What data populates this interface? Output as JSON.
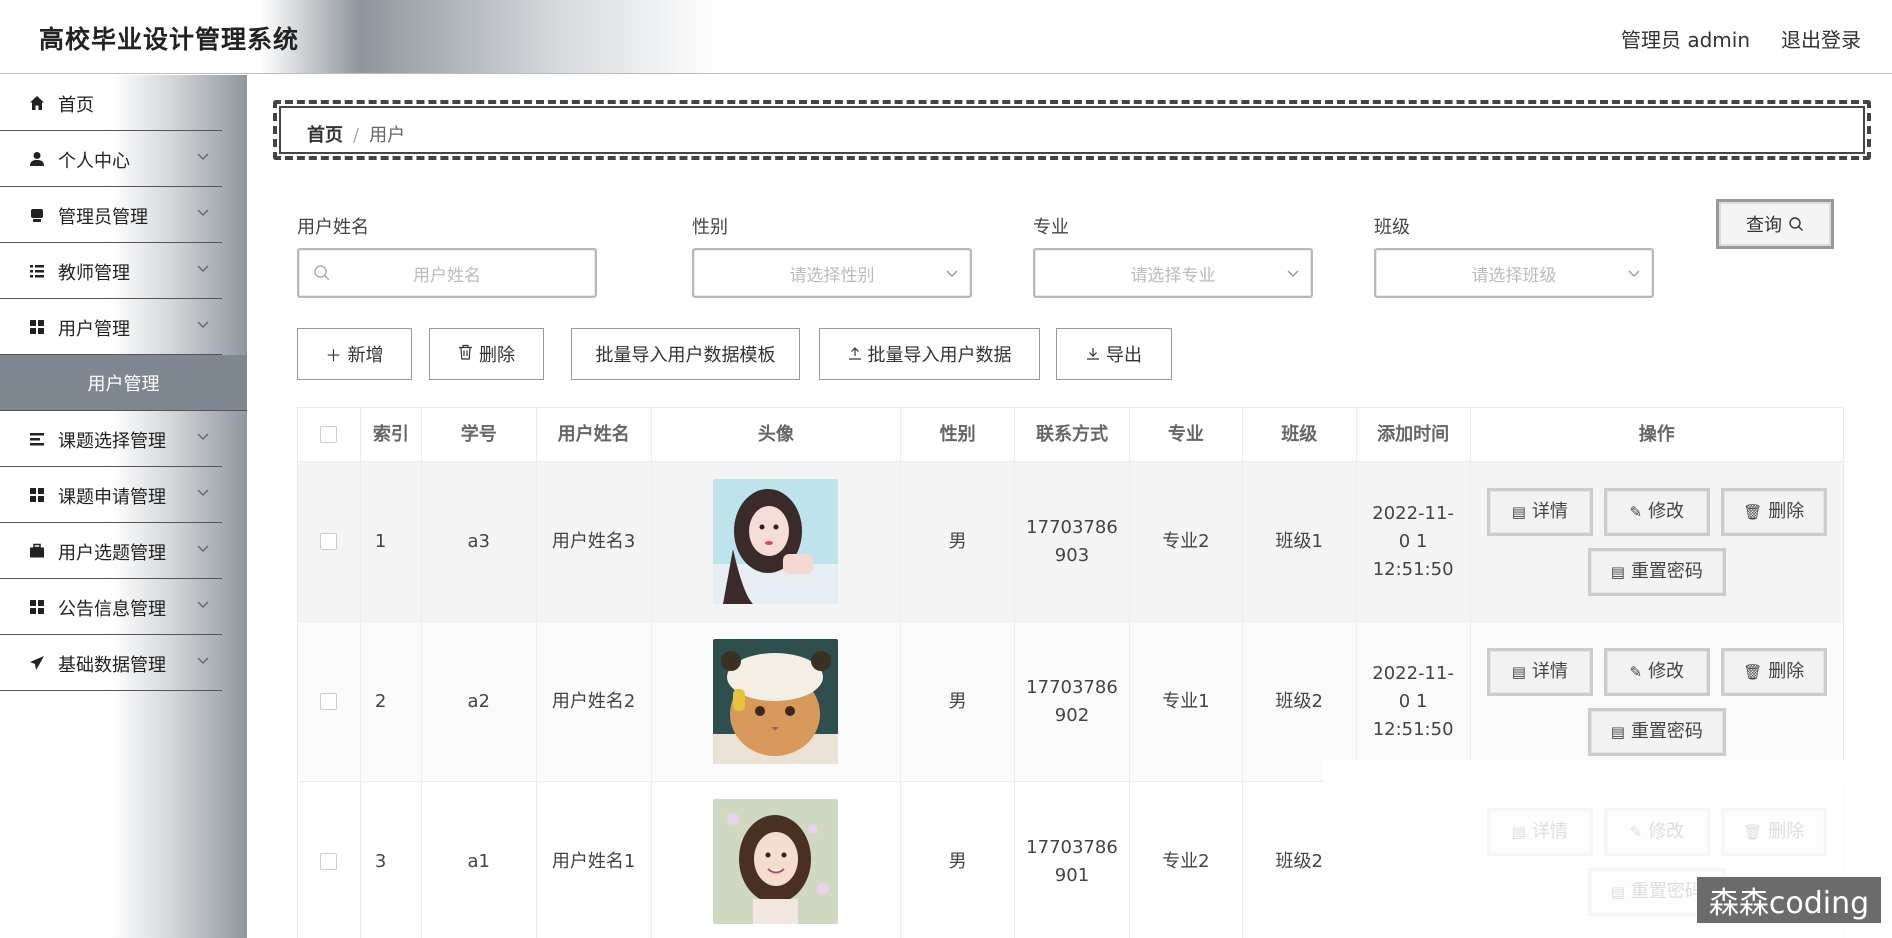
{
  "header": {
    "title": "高校毕业设计管理系统",
    "admin": "管理员 admin",
    "logout": "退出登录"
  },
  "sidebar": {
    "items": [
      {
        "label": "首页",
        "icon": "home-icon"
      },
      {
        "label": "个人中心",
        "icon": "user-icon"
      },
      {
        "label": "管理员管理",
        "icon": "admin-icon"
      },
      {
        "label": "教师管理",
        "icon": "list-icon"
      },
      {
        "label": "用户管理",
        "icon": "grid-icon"
      },
      {
        "label": "课题选择管理",
        "icon": "list-icon"
      },
      {
        "label": "课题申请管理",
        "icon": "grid-icon"
      },
      {
        "label": "用户选题管理",
        "icon": "briefcase-icon"
      },
      {
        "label": "公告信息管理",
        "icon": "grid-icon"
      },
      {
        "label": "基础数据管理",
        "icon": "send-icon"
      }
    ],
    "active_sub": "用户管理"
  },
  "breadcrumb": {
    "home": "首页",
    "sep": "/",
    "current": "用户"
  },
  "filters": {
    "name_label": "用户姓名",
    "name_placeholder": "用户姓名",
    "gender_label": "性别",
    "gender_placeholder": "请选择性别",
    "major_label": "专业",
    "major_placeholder": "请选择专业",
    "class_label": "班级",
    "class_placeholder": "请选择班级",
    "query": "查询"
  },
  "actions": {
    "add": "新增",
    "delete": "删除",
    "template": "批量导入用户数据模板",
    "import": "批量导入用户数据",
    "export": "导出"
  },
  "table": {
    "headers": [
      "索引",
      "学号",
      "用户姓名",
      "头像",
      "性别",
      "联系方式",
      "专业",
      "班级",
      "添加时间",
      "操作"
    ],
    "rows": [
      {
        "index": "1",
        "sid": "a3",
        "name": "用户姓名3",
        "gender": "男",
        "phone": "17703786 903",
        "major": "专业2",
        "class": "班级1",
        "time": "2022-11-0 1 12:51:50"
      },
      {
        "index": "2",
        "sid": "a2",
        "name": "用户姓名2",
        "gender": "男",
        "phone": "17703786 902",
        "major": "专业1",
        "class": "班级2",
        "time": "2022-11-0 1 12:51:50"
      },
      {
        "index": "3",
        "sid": "a1",
        "name": "用户姓名1",
        "gender": "男",
        "phone": "17703786 901",
        "major": "专业2",
        "class": "班级2",
        "time": ""
      }
    ],
    "ops": {
      "detail": "详情",
      "edit": "修改",
      "delete": "删除",
      "reset": "重置密码"
    }
  },
  "watermark": "森森coding"
}
